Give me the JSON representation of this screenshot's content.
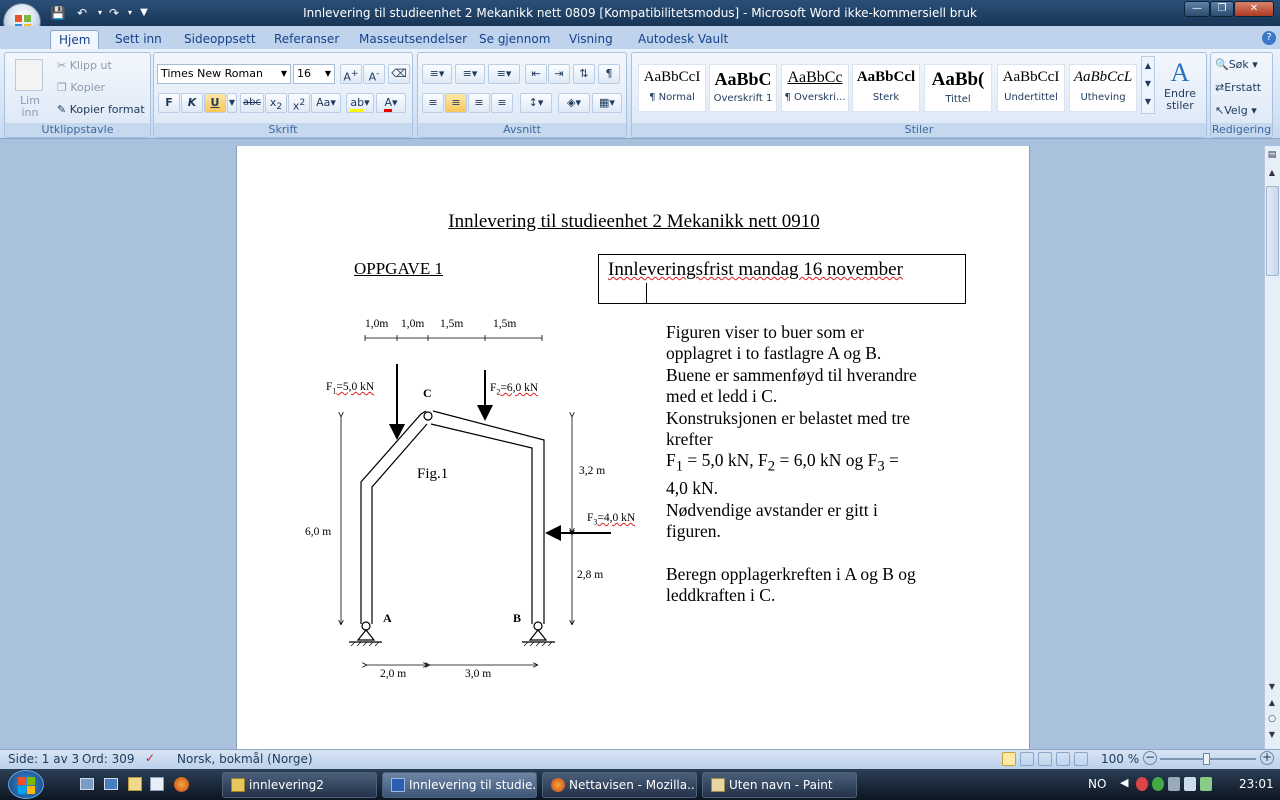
{
  "window": {
    "title": "Innlevering til studieenhet 2 Mekanikk nett 0809 [Kompatibilitetsmodus]  -  Microsoft Word ikke-kommersiell bruk"
  },
  "tabs": [
    "Hjem",
    "Sett inn",
    "Sideoppsett",
    "Referanser",
    "Masseutsendelser",
    "Se gjennom",
    "Visning",
    "Autodesk Vault"
  ],
  "ribbon": {
    "clipboard": {
      "paste": "Lim inn",
      "cut": "Klipp ut",
      "copy": "Kopier",
      "format_painter": "Kopier format",
      "label": "Utklippstavle"
    },
    "font": {
      "name": "Times New Roman",
      "size": "16",
      "label": "Skrift"
    },
    "paragraph": {
      "label": "Avsnitt"
    },
    "styles": {
      "label": "Stiler",
      "items": [
        {
          "sample": "AaBbCcI",
          "name": "¶ Normal"
        },
        {
          "sample": "AaBbC",
          "name": "Overskrift 1"
        },
        {
          "sample": "AaBbCc",
          "name": "¶ Overskri..."
        },
        {
          "sample": "AaBbCcl",
          "name": "Sterk"
        },
        {
          "sample": "AaBb(",
          "name": "Tittel"
        },
        {
          "sample": "AaBbCcI",
          "name": "Undertittel"
        },
        {
          "sample": "AaBbCcL",
          "name": "Utheving"
        }
      ],
      "change": "Endre stiler"
    },
    "editing": {
      "find": "Søk",
      "replace": "Erstatt",
      "select": "Velg",
      "label": "Redigering"
    }
  },
  "document": {
    "heading": "Innlevering til studieenhet 2 Mekanikk nett 0910",
    "task": "OPPGAVE 1",
    "deadline": "Innleveringsfrist  mandag 16 november",
    "text": [
      "Figuren viser to buer som er",
      "opplagret i to fastlagre A og B.",
      "Buene er sammenføyd til hverandre",
      "med et ledd i C.",
      "Konstruksjonen er belastet med tre",
      "krefter",
      "4,0 kN.",
      "Nødvendige avstander er gitt i",
      "figuren.",
      "Beregn opplagerkreften i A og B og",
      "leddkraften i C."
    ],
    "forces_line": {
      "f1": "F",
      "s1": "1",
      "e1": " = 5,0 kN, F",
      "s2": "2",
      "e2": " = 6,0 kN og F",
      "s3": "3",
      "e3": " ="
    },
    "figure": {
      "dims_top": [
        "1,0m",
        "1,0m",
        "1,5m",
        "1,5m"
      ],
      "f1": {
        "name": "F",
        "sub": "1",
        "val": "=5,0 kN"
      },
      "f2": {
        "name": "F",
        "sub": "2",
        "val": "=6,0 kN"
      },
      "f3": {
        "name": "F",
        "sub": "3",
        "val": "=4,0 kN"
      },
      "C": "C",
      "fig": "Fig.1",
      "h_left": "6,0 m",
      "h_right_top": "3,2 m",
      "h_right_bottom": "2,8 m",
      "A": "A",
      "B": "B",
      "dims_bottom": [
        "2,0 m",
        "3,0 m"
      ]
    }
  },
  "status": {
    "page": "Side: 1 av 3",
    "words": "Ord: 309",
    "language": "Norsk, bokmål (Norge)",
    "zoom": "100 %"
  },
  "taskbar": {
    "items": [
      "innlevering2",
      "Innlevering til studie...",
      "Nettavisen - Mozilla...",
      "Uten navn - Paint"
    ],
    "lang": "NO",
    "time": "23:01"
  }
}
